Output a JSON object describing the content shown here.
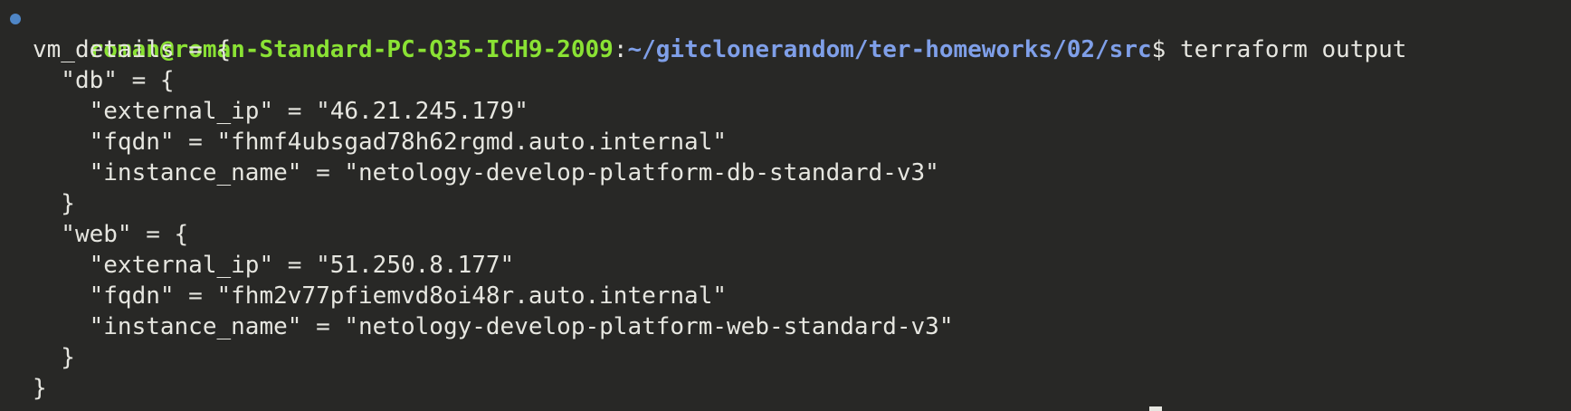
{
  "prompt": {
    "user_host": "roman@roman-Standard-PC-Q35-ICH9-2009",
    "colon": ":",
    "path": "~/gitclonerandom/ter-homeworks/02/src",
    "dollar": "$",
    "command": " terraform output"
  },
  "output_lines": [
    "vm_details = {",
    "  \"db\" = {",
    "    \"external_ip\" = \"46.21.245.179\"",
    "    \"fqdn\" = \"fhmf4ubsgad78h62rgmd.auto.internal\"",
    "    \"instance_name\" = \"netology-develop-platform-db-standard-v3\"",
    "  }",
    "  \"web\" = {",
    "    \"external_ip\" = \"51.250.8.177\"",
    "    \"fqdn\" = \"fhm2v77pfiemvd8oi48r.auto.internal\"",
    "    \"instance_name\" = \"netology-develop-platform-web-standard-v3\"",
    "  }",
    "}"
  ],
  "colors": {
    "background": "#282826",
    "user_host": "#8ae234",
    "path": "#7f9fe8",
    "text": "#e6e6e0",
    "prompt_dot": "#4f86c6"
  }
}
